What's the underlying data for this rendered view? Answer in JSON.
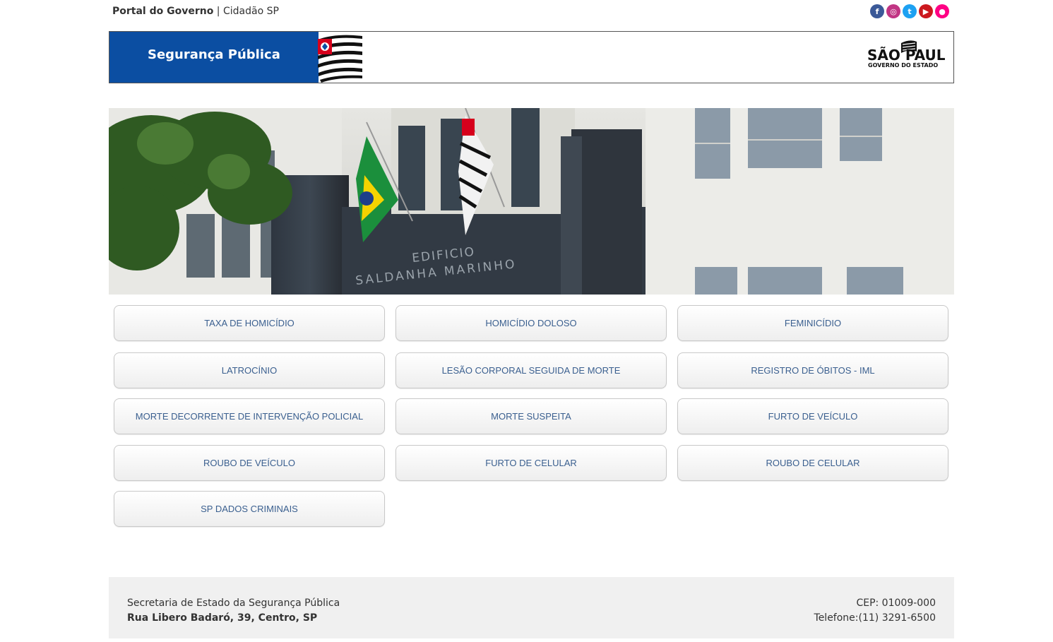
{
  "topbar": {
    "portal": "Portal do Governo",
    "separator": " | ",
    "cidadao": "Cidadão SP",
    "social": [
      {
        "icon": "facebook-icon",
        "glyph": "f",
        "color": "#3b5998"
      },
      {
        "icon": "instagram-icon",
        "glyph": "◎",
        "color": "#c13584"
      },
      {
        "icon": "twitter-icon",
        "glyph": "t",
        "color": "#1da1f2"
      },
      {
        "icon": "youtube-icon",
        "glyph": "▶",
        "color": "#cc181e"
      },
      {
        "icon": "flickr-icon",
        "glyph": "●",
        "color": "#ff0084"
      }
    ]
  },
  "banner": {
    "title": "Segurança Pública",
    "logo_main": "SÃO PAULO",
    "logo_sub": "GOVERNO DO ESTADO",
    "brand_color": "#0b4ea2"
  },
  "hero": {
    "building_line1": "EDIFICIO",
    "building_line2": "SALDANHA MARINHO"
  },
  "buttons": [
    {
      "label": "TAXA DE HOMICÍDIO"
    },
    {
      "label": "HOMICÍDIO DOLOSO"
    },
    {
      "label": "FEMINICÍDIO"
    },
    {
      "label": "LATROCÍNIO"
    },
    {
      "label": "LESÃO CORPORAL SEGUIDA DE MORTE"
    },
    {
      "label": "REGISTRO DE ÓBITOS - IML"
    },
    {
      "label": "MORTE DECORRENTE DE INTERVENÇÃO POLICIAL"
    },
    {
      "label": "MORTE SUSPEITA"
    },
    {
      "label": "FURTO DE VEÍCULO"
    },
    {
      "label": "ROUBO DE VEÍCULO"
    },
    {
      "label": "FURTO DE CELULAR"
    },
    {
      "label": "ROUBO DE CELULAR"
    },
    {
      "label": "SP DADOS CRIMINAIS"
    }
  ],
  "footer": {
    "org": "Secretaria de Estado da Segurança Pública",
    "address": "Rua Libero Badaró, 39, Centro, SP",
    "cep": "CEP: 01009-000",
    "phone": "Telefone:(11) 3291-6500"
  }
}
